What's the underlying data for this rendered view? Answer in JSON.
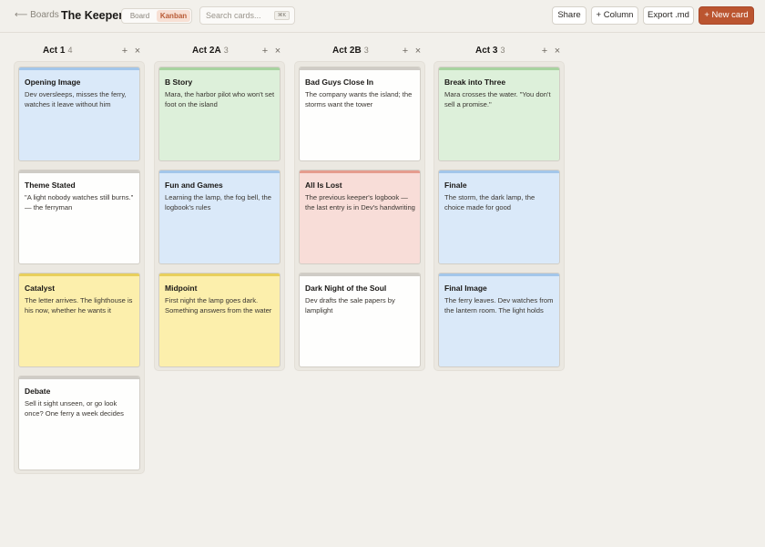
{
  "header": {
    "back_label": "⟵ Boards",
    "title": "The Keeper",
    "views": [
      {
        "label": "Board",
        "active": false
      },
      {
        "label": "Kanban",
        "active": true
      }
    ],
    "search": {
      "placeholder": "Search cards...",
      "value": "",
      "shortcut": "⌘K"
    },
    "share_label": "Share",
    "add_column_label": "+ Column",
    "export_label": "Export .md",
    "new_card_label": "+ New card",
    "accent_color": "#bb5530"
  },
  "colors": {
    "blue": {
      "fill": "#dae9f9",
      "strip": "#a3c6ea"
    },
    "green": {
      "fill": "#ddf0da",
      "strip": "#a8d3a0"
    },
    "white": {
      "fill": "#fefefd",
      "strip": "#cfccc6"
    },
    "yellow": {
      "fill": "#fcefac",
      "strip": "#e8cf5c"
    },
    "red": {
      "fill": "#f8ddd8",
      "strip": "#e59c8e"
    }
  },
  "columns": [
    {
      "title": "Act 1",
      "count": "4",
      "cards": [
        {
          "title": "Opening Image",
          "desc": "Dev oversleeps, misses the ferry, watches it leave without him",
          "color": "blue"
        },
        {
          "title": "Theme Stated",
          "desc": "\"A light nobody watches still burns.\" — the ferryman",
          "color": "white"
        },
        {
          "title": "Catalyst",
          "desc": "The letter arrives. The lighthouse is his now, whether he wants it",
          "color": "yellow"
        },
        {
          "title": "Debate",
          "desc": "Sell it sight unseen, or go look once? One ferry a week decides",
          "color": "white"
        }
      ]
    },
    {
      "title": "Act 2A",
      "count": "3",
      "cards": [
        {
          "title": "B Story",
          "desc": "Mara, the harbor pilot who won't set foot on the island",
          "color": "green"
        },
        {
          "title": "Fun and Games",
          "desc": "Learning the lamp, the fog bell, the logbook's rules",
          "color": "blue"
        },
        {
          "title": "Midpoint",
          "desc": "First night the lamp goes dark. Something answers from the water",
          "color": "yellow"
        }
      ]
    },
    {
      "title": "Act 2B",
      "count": "3",
      "cards": [
        {
          "title": "Bad Guys Close In",
          "desc": "The company wants the island; the storms want the tower",
          "color": "white"
        },
        {
          "title": "All Is Lost",
          "desc": "The previous keeper's logbook — the last entry is in Dev's handwriting",
          "color": "red"
        },
        {
          "title": "Dark Night of the Soul",
          "desc": "Dev drafts the sale papers by lamplight",
          "color": "white"
        }
      ]
    },
    {
      "title": "Act 3",
      "count": "3",
      "cards": [
        {
          "title": "Break into Three",
          "desc": "Mara crosses the water. \"You don't sell a promise.\"",
          "color": "green"
        },
        {
          "title": "Finale",
          "desc": "The storm, the dark lamp, the choice made for good",
          "color": "blue"
        },
        {
          "title": "Final Image",
          "desc": "The ferry leaves. Dev watches from the lantern room. The light holds",
          "color": "blue"
        }
      ]
    }
  ]
}
